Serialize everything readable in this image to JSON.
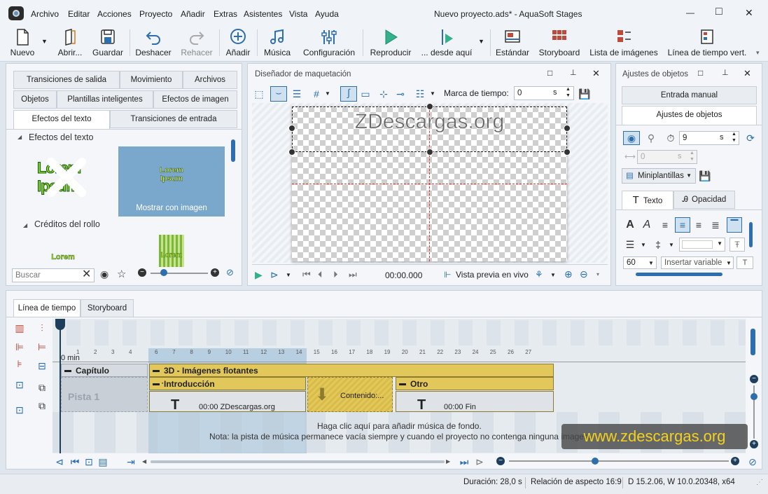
{
  "window": {
    "title": "Nuevo proyecto.ads* - AquaSoft Stages",
    "min": "—",
    "max": "□",
    "close": "✕"
  },
  "menu": [
    "Archivo",
    "Editar",
    "Acciones",
    "Proyecto",
    "Añadir",
    "Extras",
    "Asistentes",
    "Vista",
    "Ayuda"
  ],
  "toolbar": {
    "nuevo": "Nuevo",
    "abrir": "Abrir...",
    "guardar": "Guardar",
    "deshacer": "Deshacer",
    "rehacer": "Rehacer",
    "anadir": "Añadir",
    "musica": "Música",
    "configuracion": "Configuración",
    "reproducir": "Reproducir",
    "desde_aqui": "... desde aquí",
    "estandar": "Estándar",
    "storyboard": "Storyboard",
    "lista_imagenes": "Lista de imágenes",
    "linea_tiempo_vert": "Línea de tiempo vert."
  },
  "left_panel": {
    "tabs_row1": [
      "Transiciones de salida",
      "Movimiento",
      "Archivos"
    ],
    "tabs_row2": [
      "Objetos",
      "Plantillas inteligentes",
      "Efectos de imagen"
    ],
    "tabs_row3": [
      "Efectos del texto",
      "Transiciones de entrada"
    ],
    "section1": "Efectos del texto",
    "lorem": "Lorem",
    "ipsum": "Ipsum",
    "mostrar": "Mostrar con imagen",
    "section2": "Créditos del rollo",
    "search_placeholder": "Buscar"
  },
  "designer": {
    "title": "Diseñador de maquetación",
    "marca_label": "Marca de tiempo:",
    "marca_value": "0",
    "unit": "s",
    "overlay_text": "ZDescargas.org",
    "time": "00:00.000",
    "vista_previa": "Vista previa en vivo"
  },
  "props": {
    "title": "Ajustes de objetos",
    "tab_manual": "Entrada manual",
    "tab_ajustes": "Ajustes de objetos",
    "duration_value": "9",
    "unit": "s",
    "pos_value": "0",
    "miniplantillas": "Miniplantillas",
    "tab_texto": "Texto",
    "tab_opacidad": "Opacidad",
    "font_size": "60",
    "insertar": "Insertar variable"
  },
  "timeline": {
    "tab_linea": "Línea de tiempo",
    "tab_storyboard": "Storyboard",
    "ruler_left": [
      "1",
      "2",
      "3",
      "4"
    ],
    "ruler_right": [
      "6",
      "7",
      "8",
      "9",
      "10",
      "11",
      "12",
      "13",
      "14",
      "15",
      "16",
      "17",
      "18",
      "19",
      "20",
      "21",
      "22",
      "23",
      "24",
      "25",
      "26",
      "27"
    ],
    "min_label": "0 min",
    "capitulo": "Capítulo",
    "pista": "Pista 1",
    "imagenes": "3D - Imágenes flotantes",
    "introduccion": "Introducción",
    "otro": "Otro",
    "contenido": "Contenido:...",
    "intro_item": "00:00 ZDescargas.org",
    "otro_item": "00:00 Fin",
    "music_line1": "Haga clic aquí para añadir música de fondo.",
    "music_line2": "Nota: la pista de música permanece vacía siempre y cuando el proyecto no contenga ninguna imagen."
  },
  "watermark": "www.zdescargas.org",
  "status": {
    "duracion": "Duración: 28,0 s",
    "relacion": "Relación de aspecto 16:9",
    "version": "D 15.2.06, W 10.0.20348, x64"
  },
  "colors": {
    "accent": "#2d6fae",
    "track_yellow": "#e2c75a",
    "highlight": "#a8c4dc"
  }
}
